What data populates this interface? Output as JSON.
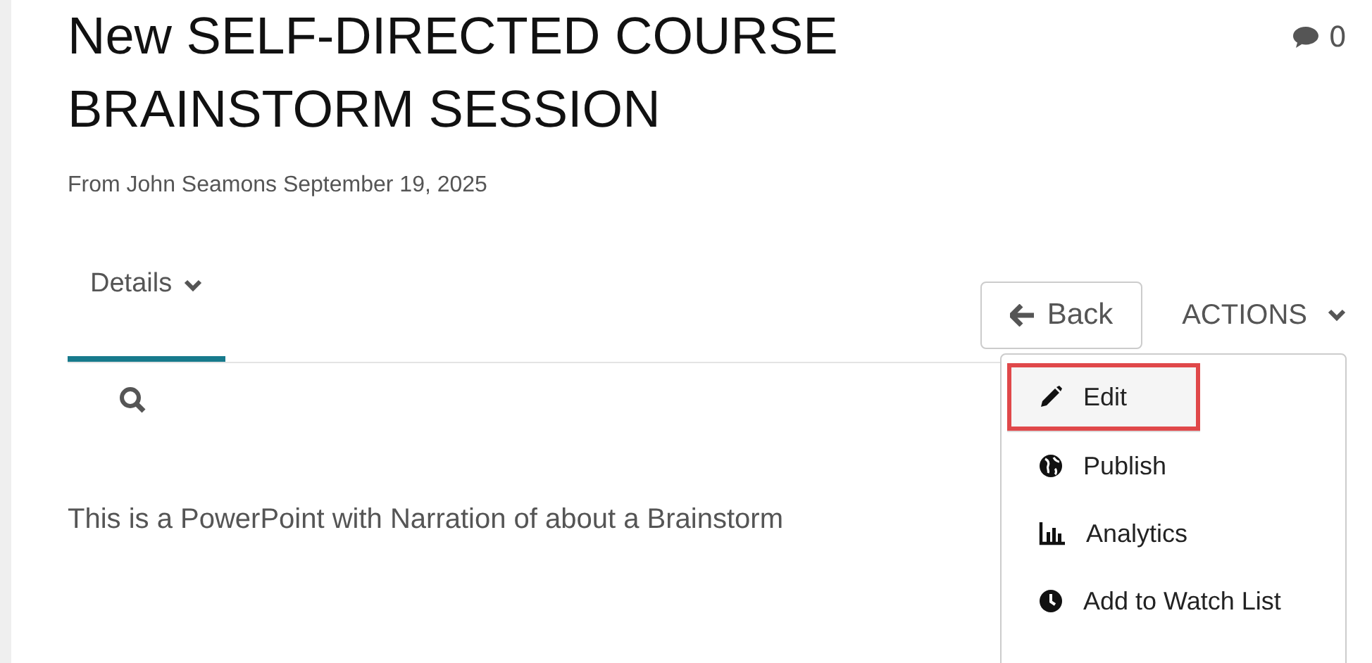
{
  "title": "New SELF-DIRECTED COURSE BRAINSTORM SESSION",
  "comment_count": "0",
  "byline": "From John Seamons September 19, 2025",
  "tabs": [
    {
      "label": "Details",
      "selected": true
    }
  ],
  "back_button": "Back",
  "actions_label": "ACTIONS",
  "actions_menu": [
    {
      "kind": "edit",
      "label": "Edit",
      "highlighted": true
    },
    {
      "kind": "publish",
      "label": "Publish",
      "highlighted": false
    },
    {
      "kind": "analytics",
      "label": "Analytics",
      "highlighted": false
    },
    {
      "kind": "watch",
      "label": "Add to Watch List",
      "highlighted": false
    }
  ],
  "description": "This is a PowerPoint with Narration of about a Brainstorm"
}
